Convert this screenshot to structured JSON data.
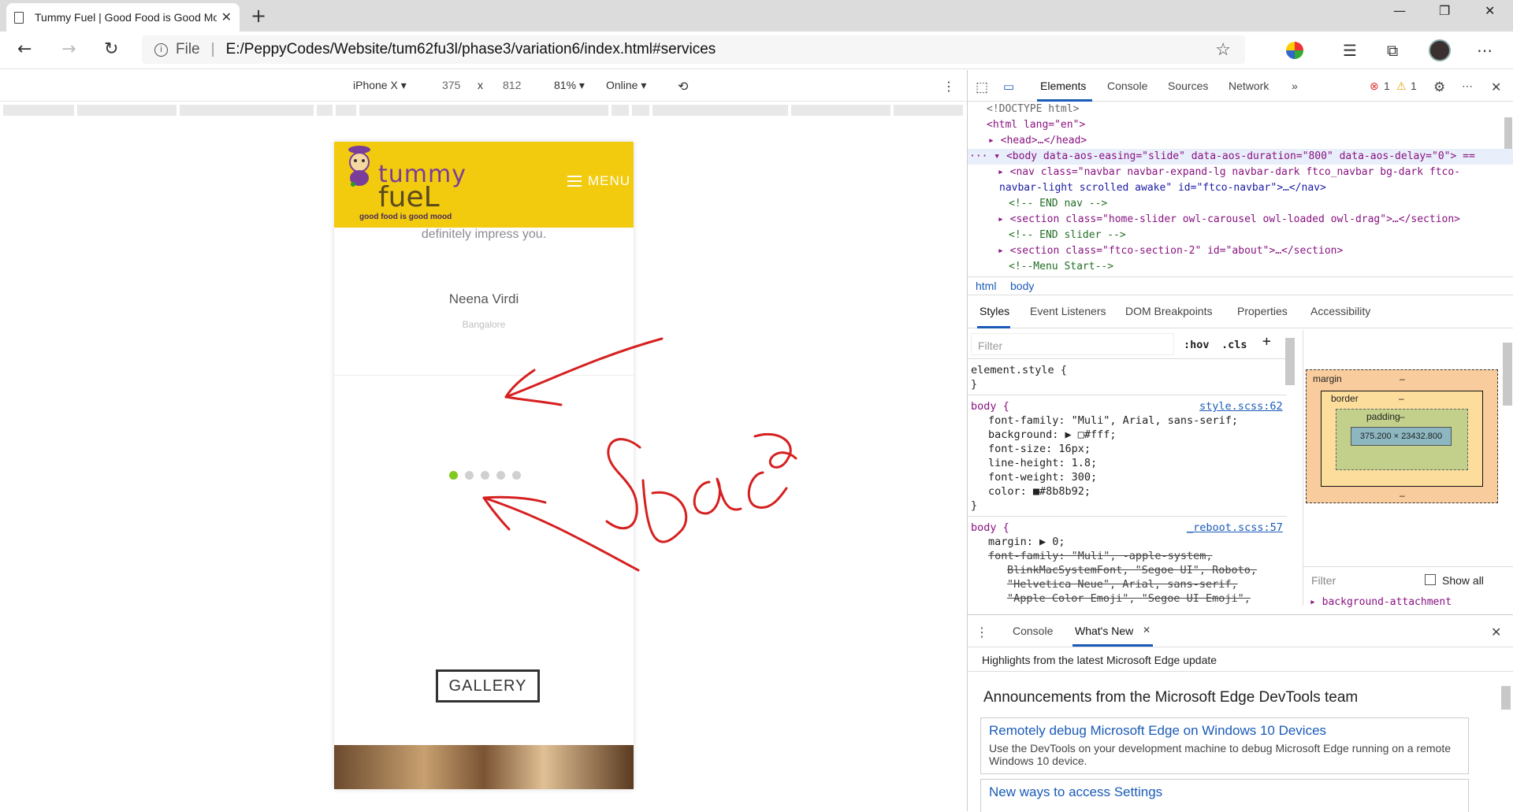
{
  "browser": {
    "tab_title": "Tummy Fuel | Good Food is Good Mood",
    "address_scheme": "File",
    "address_url": "E:/PeppyCodes/Website/tum62fu3l/phase3/variation6/index.html#services"
  },
  "device_toolbar": {
    "device": "iPhone X",
    "width": "375",
    "times": "x",
    "height": "812",
    "zoom": "81%",
    "network": "Online"
  },
  "site": {
    "logo_top": "tummy",
    "logo_bottom": "fueL",
    "tagline": "good food is good mood",
    "menu_label": "MENU",
    "testimonial_text": "definitely impress you.",
    "reviewer_name": "Neena Virdi",
    "reviewer_city": "Bangalore",
    "gallery_label": "GALLERY",
    "carousel_dots": 5,
    "active_dot": 1
  },
  "annotation": {
    "word": "Space",
    "color": "#d62020"
  },
  "devtools": {
    "tabs": [
      "Elements",
      "Console",
      "Sources",
      "Network"
    ],
    "errors": "1",
    "warnings": "1",
    "dom_lines": [
      "<!DOCTYPE html>",
      "<html lang=\"en\">",
      "<head>…</head>",
      "<body data-aos-easing=\"slide\" data-aos-duration=\"800\" data-aos-delay=\"0\"> ==",
      "<nav class=\"navbar navbar-expand-lg navbar-dark ftco_navbar bg-dark ftco-",
      "navbar-light scrolled awake\" id=\"ftco-navbar\">…</nav>",
      "<!-- END nav -->",
      "<section class=\"home-slider owl-carousel owl-loaded owl-drag\">…</section>",
      "<!-- END slider -->",
      "<section class=\"ftco-section-2\" id=\"about\">…</section>",
      "<!--Menu Start-->"
    ],
    "breadcrumbs": [
      "html",
      "body"
    ],
    "style_tabs": [
      "Styles",
      "Event Listeners",
      "DOM Breakpoints",
      "Properties",
      "Accessibility"
    ],
    "filter_placeholder": "Filter",
    "hov": ":hov",
    "cls": ".cls",
    "element_style": "element.style {",
    "rule1_selector": "body {",
    "rule1_source": "style.scss:62",
    "rule1_props": [
      "font-family: \"Muli\", Arial, sans-serif;",
      "background: ▶ □#fff;",
      "font-size: 16px;",
      "line-height: 1.8;",
      "font-weight: 300;",
      "color: ■#8b8b92;"
    ],
    "rule2_selector": "body {",
    "rule2_source": "_reboot.scss:57",
    "rule2_props": [
      "margin: ▶ 0;",
      "font-family: \"Muli\", -apple-system,",
      "BlinkMacSystemFont, \"Segoe UI\", Roboto,",
      "\"Helvetica Neue\", Arial, sans-serif,",
      "\"Apple Color Emoji\", \"Segoe UI Emoji\","
    ],
    "box_model": {
      "margin": "margin",
      "border": "border",
      "padding": "padding",
      "content": "375.200 × 23432.800",
      "dash": "–"
    },
    "computed_filter": "Filter",
    "show_all": "Show all",
    "computed_prop": "background-attachment",
    "drawer_tabs": [
      "Console",
      "What's New"
    ],
    "whats_new_header": "Highlights from the latest Microsoft Edge update",
    "announcements_title": "Announcements from the Microsoft Edge DevTools team",
    "card1_title": "Remotely debug Microsoft Edge on Windows 10 Devices",
    "card1_body": "Use the DevTools on your development machine to debug Microsoft Edge running on a remote Windows 10 device.",
    "card2_title": "New ways to access Settings"
  }
}
